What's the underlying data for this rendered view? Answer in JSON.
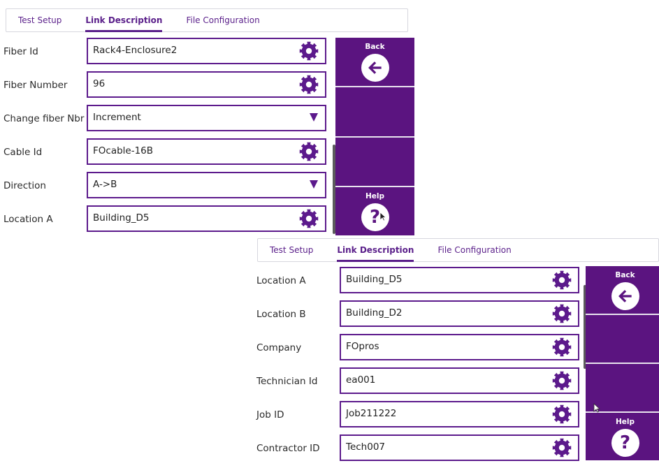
{
  "tabs": [
    "Test Setup",
    "Link Description",
    "File Configuration"
  ],
  "panel1": {
    "rows": [
      {
        "label": "Fiber Id",
        "value": "Rack4-Enclosure2",
        "control": "gear"
      },
      {
        "label": "Fiber Number",
        "value": "96",
        "control": "gear"
      },
      {
        "label": "Change fiber Nbr",
        "value": "Increment",
        "control": "dropdown"
      },
      {
        "label": "Cable Id",
        "value": "FOcable-16B",
        "control": "gear"
      },
      {
        "label": "Direction",
        "value": "A->B",
        "control": "dropdown"
      },
      {
        "label": "Location A",
        "value": "Building_D5",
        "control": "gear"
      }
    ]
  },
  "panel2": {
    "rows": [
      {
        "label": "Location A",
        "value": "Building_D5",
        "control": "gear"
      },
      {
        "label": "Location B",
        "value": "Building_D2",
        "control": "gear"
      },
      {
        "label": "Company",
        "value": "FOpros",
        "control": "gear"
      },
      {
        "label": "Technician Id",
        "value": "ea001",
        "control": "gear"
      },
      {
        "label": "Job ID",
        "value": "Job211222",
        "control": "gear"
      },
      {
        "label": "Contractor ID",
        "value": "Tech007",
        "control": "gear"
      }
    ]
  },
  "sidebar": {
    "back_label": "Back",
    "help_label": "Help",
    "back_icon": "arrow-left-icon",
    "help_icon": "question-icon"
  },
  "colors": {
    "accent": "#5b1480",
    "field_border": "#5c1a8c",
    "tab_text": "#5a1f8a"
  }
}
